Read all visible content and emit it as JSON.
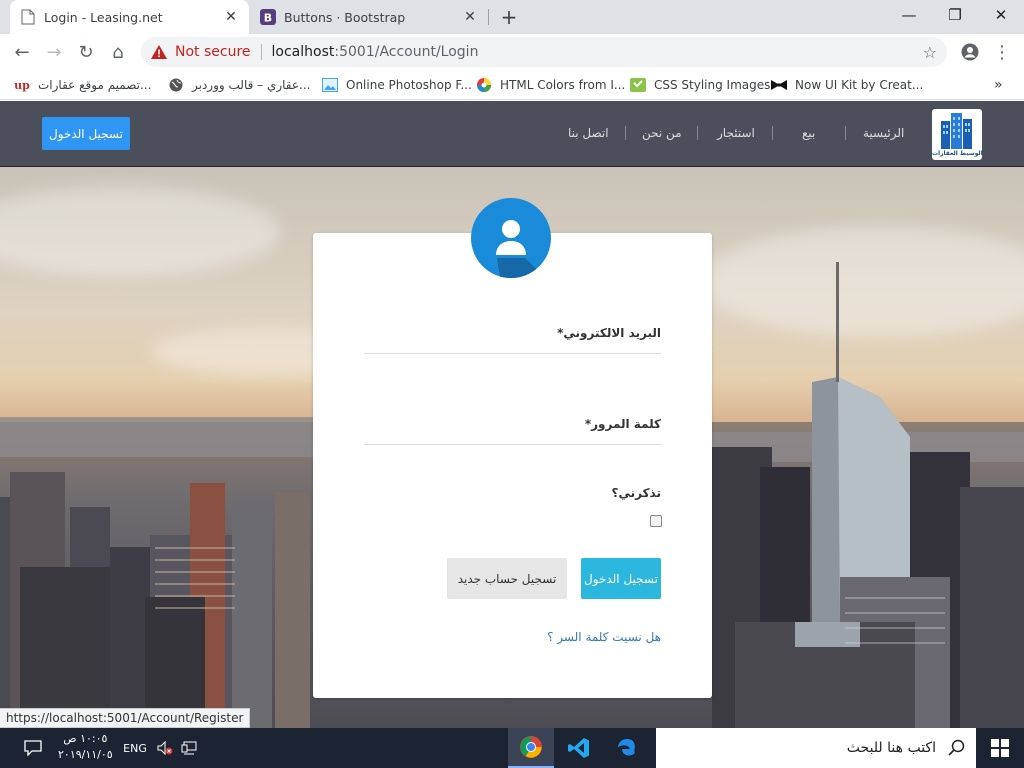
{
  "browser": {
    "tabs": [
      {
        "title": "Login - Leasing.net",
        "active": true,
        "favicon": "page-icon"
      },
      {
        "title": "Buttons · Bootstrap",
        "active": false,
        "favicon": "bootstrap-icon"
      }
    ],
    "address": {
      "security_text": "Not secure",
      "host": "localhost",
      "path": ":5001/Account/Login"
    },
    "bookmarks": [
      {
        "label": "تصميم موقع عقارات...",
        "icon": "up-icon"
      },
      {
        "label": "عقاري – قالب ووردبر...",
        "icon": "globe-icon"
      },
      {
        "label": "Online Photoshop F...",
        "icon": "image-icon"
      },
      {
        "label": "HTML Colors from I...",
        "icon": "color-wheel-icon"
      },
      {
        "label": "CSS Styling Images",
        "icon": "css-icon"
      },
      {
        "label": "Now UI Kit by Creat...",
        "icon": "bowtie-icon"
      }
    ],
    "overflow_label": "»",
    "status_url": "https://localhost:5001/Account/Register"
  },
  "site": {
    "nav": [
      {
        "label": "الرئيسية"
      },
      {
        "label": "بيع"
      },
      {
        "label": "استئجار"
      },
      {
        "label": "من نحن"
      },
      {
        "label": "اتصل بنا"
      }
    ],
    "login_button": "تسجيل الدخول",
    "logo_text": "الوسيط العقارات"
  },
  "form": {
    "email_label": "البريد الالكتروني*",
    "password_label": "كلمة المرور*",
    "remember_label": "تذكرني؟",
    "remember_checked": false,
    "submit_label": "تسجيل الدخول",
    "register_label": "تسجيل حساب جديد",
    "forgot_label": "هل نسيت كلمة السر ؟"
  },
  "taskbar": {
    "time": "١٠:٠٥ ص",
    "date": "٢٠١٩/١١/٠٥",
    "language": "ENG",
    "search_placeholder": "اكتب هنا للبحث"
  },
  "colors": {
    "navbar": "#4b4f5c",
    "primary_button": "#2f96f3",
    "submit_button": "#2cb7de",
    "avatar": "#1a8bd8",
    "taskbar": "#1c2333"
  }
}
